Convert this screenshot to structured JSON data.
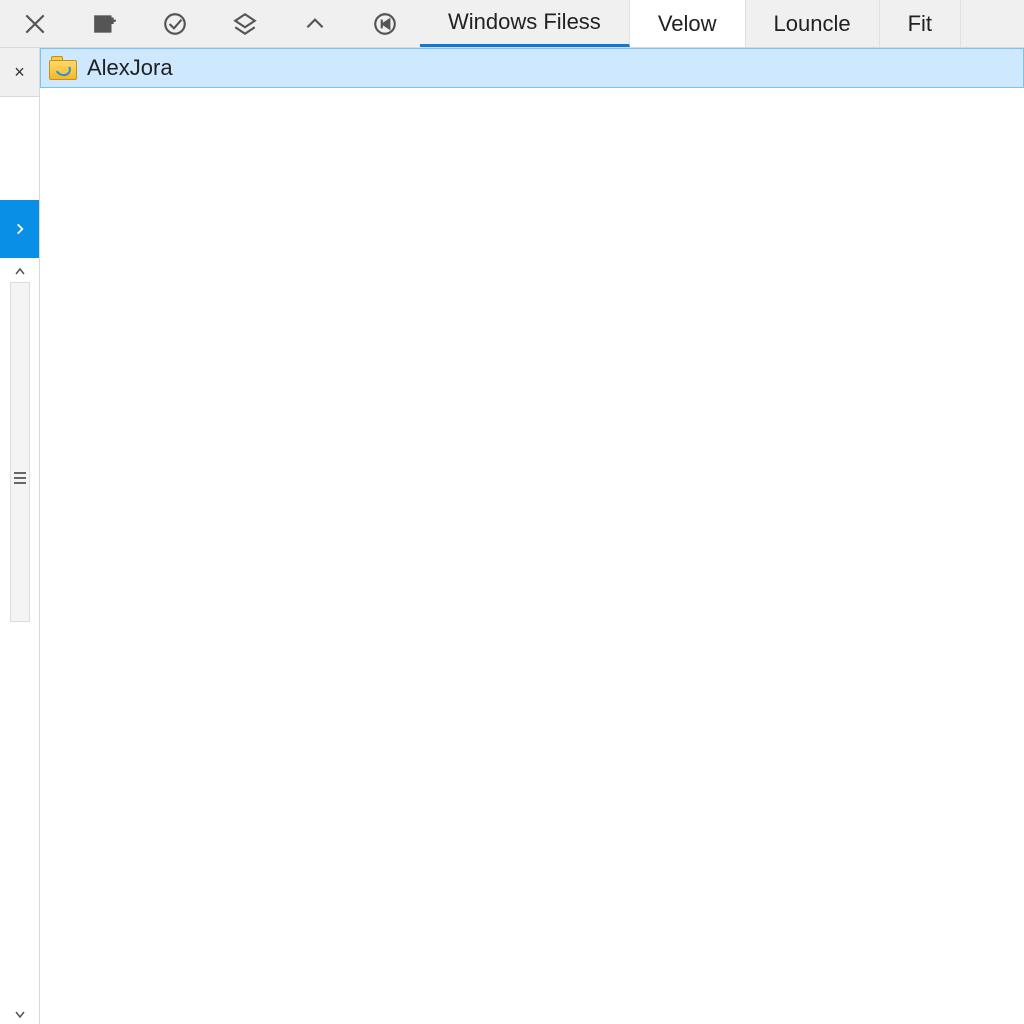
{
  "tabs": {
    "t0": "Windows Filess",
    "t1": "Velow",
    "t2": "Louncle",
    "t3": "Fit"
  },
  "content": {
    "selected_item": "AlexJora"
  }
}
